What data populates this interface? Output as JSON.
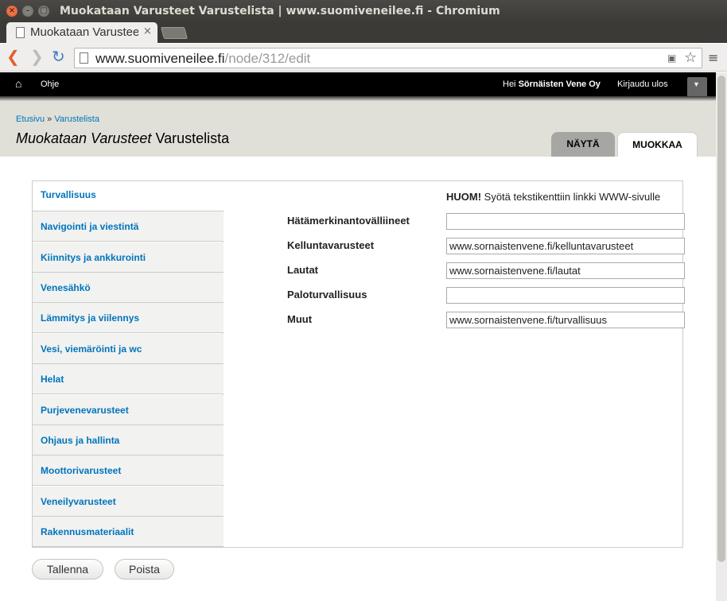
{
  "window": {
    "title": "Muokataan Varusteet Varustelista | www.suomiveneilee.fi - Chromium",
    "close_glyph": "×",
    "min_glyph": "–",
    "max_glyph": "□"
  },
  "browser": {
    "tab_title": "Muokataan Varustee",
    "tab_close": "×",
    "url_host": "www.suomiveneilee.fi",
    "url_path": "/node/312/edit",
    "icons": {
      "back": "back-arrow-icon",
      "forward": "forward-arrow-icon",
      "reload": "reload-icon",
      "star": "star-icon",
      "menu": "menu-icon"
    }
  },
  "adminbar": {
    "home_glyph": "⌂",
    "help": "Ohje",
    "greeting_prefix": "Hei ",
    "user": "Sörnäisten Vene Oy",
    "logout": "Kirjaudu ulos"
  },
  "header": {
    "breadcrumb": [
      "Etusivu",
      "Varustelista"
    ],
    "breadcrumb_sep": " » ",
    "title_em": "Muokataan Varusteet",
    "title_rest": " Varustelista",
    "tabs": [
      {
        "label": "NÄYTÄ",
        "active": false
      },
      {
        "label": "MUOKKAA",
        "active": true
      }
    ]
  },
  "vertical_tabs": [
    {
      "label": "Turvallisuus",
      "selected": true
    },
    {
      "label": "Navigointi ja viestintä"
    },
    {
      "label": "Kiinnitys ja ankkurointi"
    },
    {
      "label": "Venesähkö"
    },
    {
      "label": "Lämmitys ja viilennys"
    },
    {
      "label": "Vesi, viemäröinti ja wc"
    },
    {
      "label": "Helat"
    },
    {
      "label": "Purjevenevarusteet"
    },
    {
      "label": "Ohjaus ja hallinta"
    },
    {
      "label": "Moottorivarusteet"
    },
    {
      "label": "Veneilyvarusteet"
    },
    {
      "label": "Rakennusmateriaalit"
    }
  ],
  "form": {
    "notice_bold": "HUOM!",
    "notice_text": " Syötä tekstikenttiin linkki WWW-sivulle",
    "fields": [
      {
        "label": "Hätämerkinantovälliineet",
        "value": ""
      },
      {
        "label": "Kelluntavarusteet",
        "value": "www.sornaistenvene.fi/kelluntavarusteet"
      },
      {
        "label": "Lautat",
        "value": "www.sornaistenvene.fi/lautat"
      },
      {
        "label": "Paloturvallisuus",
        "value": ""
      },
      {
        "label": "Muut",
        "value": "www.sornaistenvene.fi/turvallisuus"
      }
    ]
  },
  "actions": {
    "save": "Tallenna",
    "delete": "Poista"
  },
  "colors": {
    "link": "#0074bd",
    "adminbar": "#000000",
    "header_bg": "#e0e0d8"
  }
}
